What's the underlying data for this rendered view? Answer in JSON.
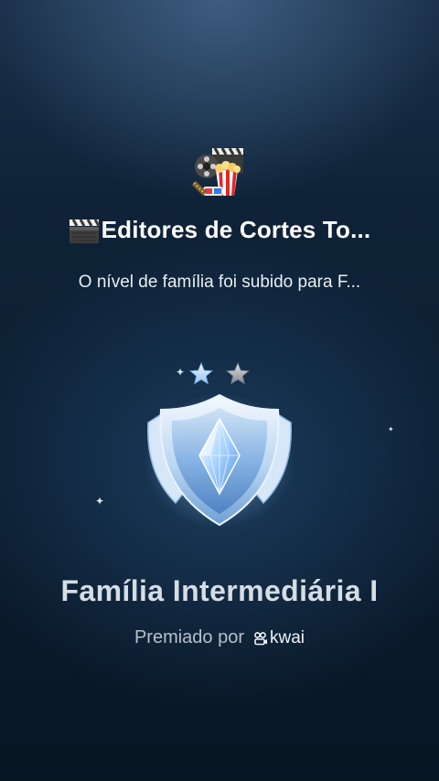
{
  "family": {
    "name": "Editores de Cortes To...",
    "name_icon": "clapperboard-icon",
    "avatar_icon": "movie-reel-popcorn-icon"
  },
  "notification": {
    "message": "O nível de família foi subido para F..."
  },
  "level": {
    "title": "Família Intermediária I",
    "stars_total": 2,
    "stars_lit": 1,
    "badge_icon": "diamond-shield-icon"
  },
  "award": {
    "prefix": "Premiado por",
    "brand": "kwai",
    "brand_icon": "kwai-logo-icon"
  },
  "colors": {
    "background_top": "#1a2f48",
    "background_bottom": "#081523",
    "badge_light": "#eaf4ff",
    "badge_blue": "#5e96d6",
    "star_silver": "#9aa4ad",
    "star_blue": "#bfe0ff"
  }
}
